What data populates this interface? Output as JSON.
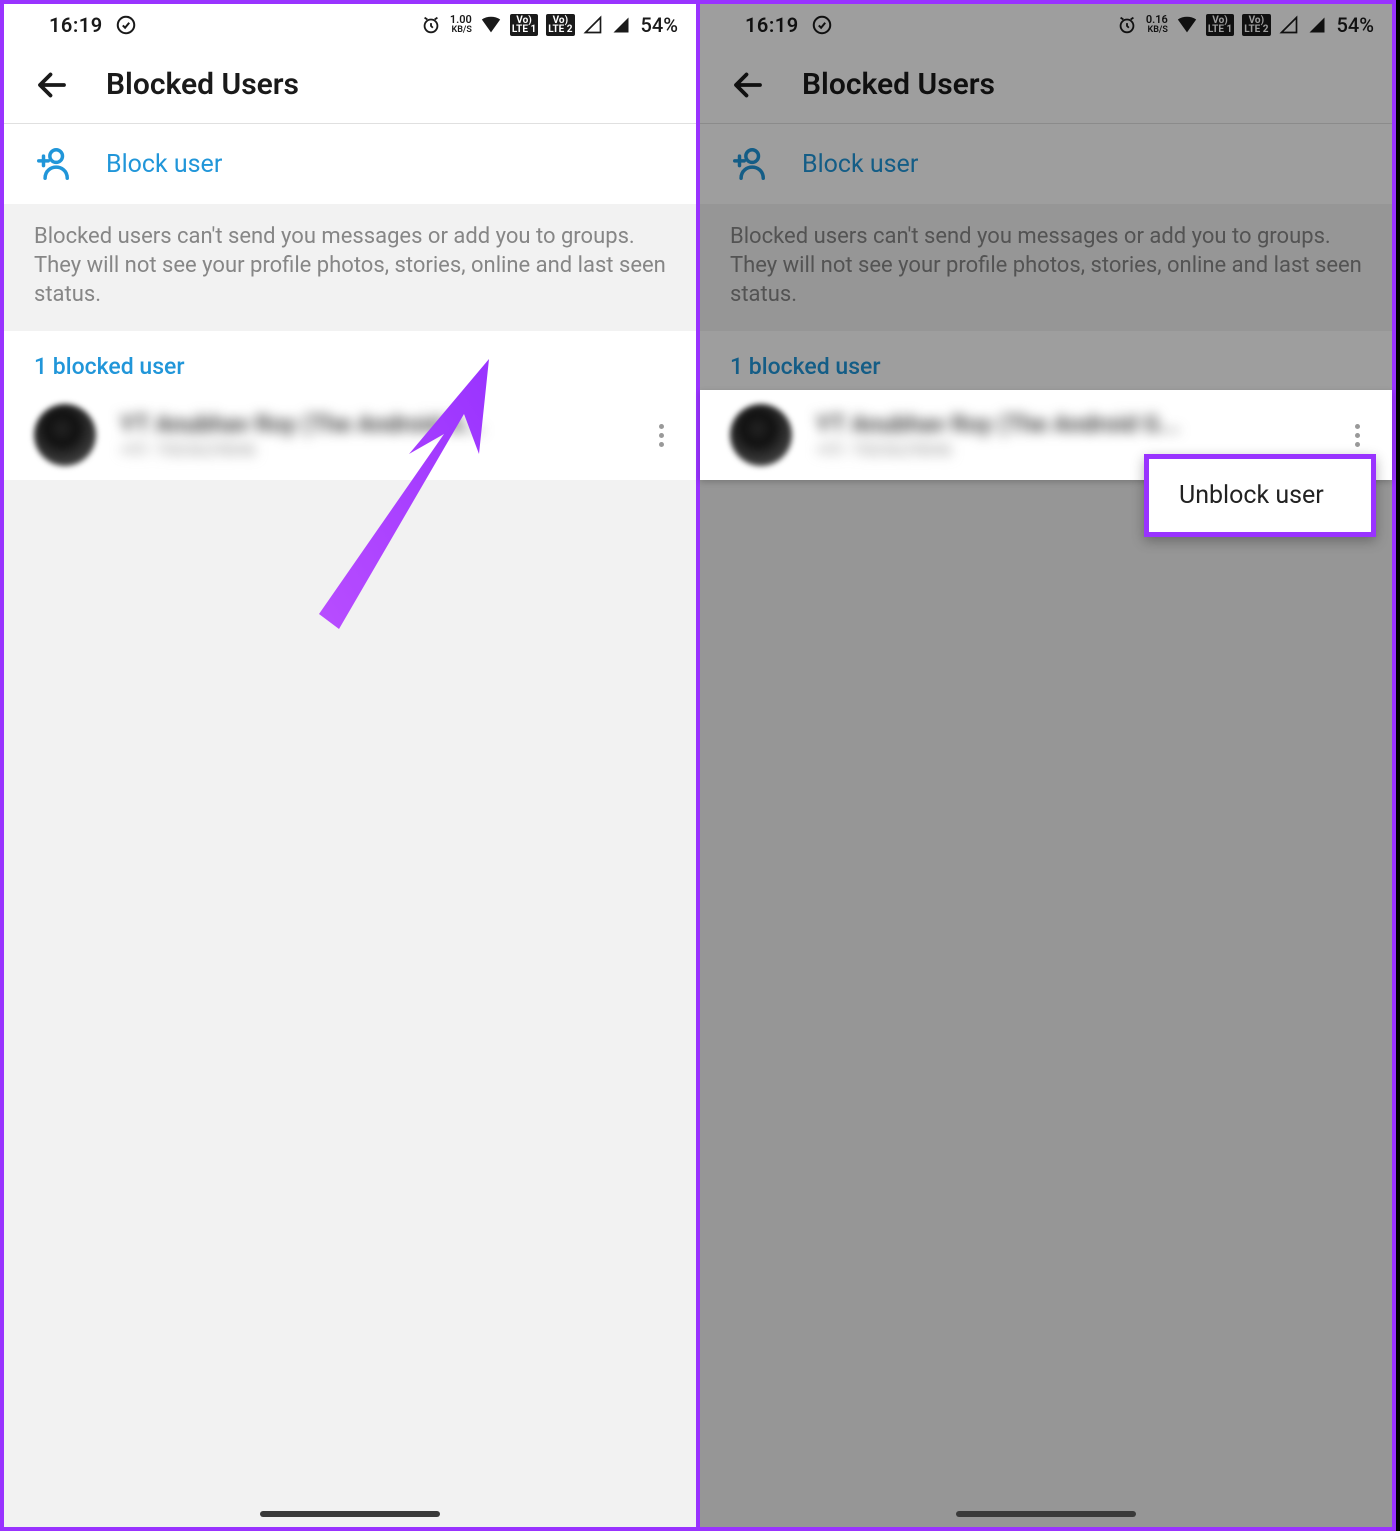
{
  "status": {
    "time": "16:19",
    "kbs_left": "1.00",
    "kbs_right": "0.16",
    "kbs_unit": "KB/S",
    "vo1": "Vo)",
    "lte1": "LTE 1",
    "vo2": "Vo)",
    "lte2": "LTE 2",
    "battery": "54%"
  },
  "header": {
    "title": "Blocked Users"
  },
  "actions": {
    "block_user": "Block user"
  },
  "info": {
    "description": "Blocked users can't send you messages or add you to groups. They will not see your profile photos, stories, online and last seen status."
  },
  "list": {
    "section_title": "1 blocked user",
    "user_name": "YT Anubhav Roy (The Android G...",
    "user_sub": "+91 7003629846"
  },
  "popup": {
    "unblock": "Unblock user"
  },
  "colors": {
    "accent": "#2196d9",
    "highlight": "#9933ff"
  }
}
